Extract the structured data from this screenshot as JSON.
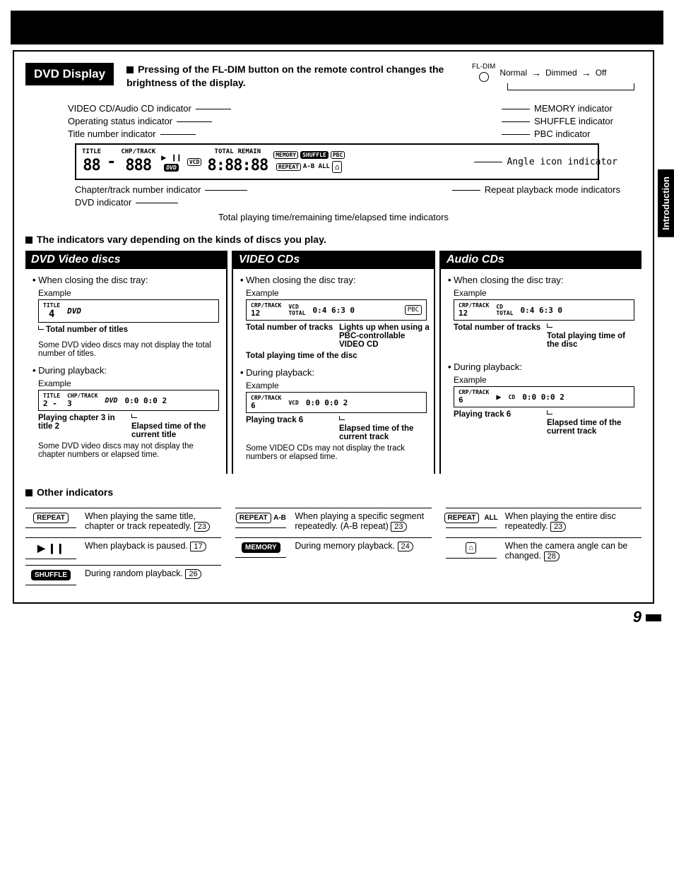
{
  "side_tab": "Introduction",
  "header": {
    "title": "DVD Display",
    "fl_dim_text": "Pressing of the FL-DIM button on the remote control changes the brightness of the display.",
    "fl_dim_label": "FL-DIM",
    "normal": "Normal",
    "dimmed": "Dimmed",
    "off": "Off"
  },
  "top_labels_left": {
    "l1": "VIDEO CD/Audio CD indicator",
    "l2": "Operating status indicator",
    "l3": "Title number indicator"
  },
  "top_labels_right": {
    "r1": "MEMORY indicator",
    "r2": "SHUFFLE indicator",
    "r3": "PBC indicator"
  },
  "display": {
    "title": "TITLE",
    "chptrack": "CHP/TRACK",
    "vcd": "VCD",
    "dvd": "DVD",
    "total": "TOTAL",
    "remain": "REMAIN",
    "memory": "MEMORY",
    "shuffle": "SHUFFLE",
    "pbc": "PBC",
    "repeat": "REPEAT",
    "ab_all": "A-B ALL",
    "seg_title": "88",
    "dash": "-",
    "seg_track": "888",
    "seg_time": "8:88:88"
  },
  "mid_right": {
    "angle": "Angle icon indicator",
    "repeat_mode": "Repeat playback mode indicators"
  },
  "bot_labels": {
    "b1": "Chapter/track number indicator",
    "b2": "DVD indicator",
    "b3": "Total playing time/remaining time/elapsed time indicators"
  },
  "sub_heading": "The indicators vary depending on the kinds of discs you play.",
  "columns": {
    "c1": {
      "heading": "DVD Video discs",
      "close": "When closing the disc tray:",
      "example": "Example",
      "disp1": {
        "tiny1": "TITLE",
        "val": "4",
        "dvd": "DVD"
      },
      "note1a": "Total number of titles",
      "note1b": "Some DVD video discs may not display the total number of titles.",
      "during": "During playback:",
      "disp2": {
        "tiny1": "TITLE",
        "v1": "2 -",
        "tiny2": "CHP/TRACK",
        "v2": "3",
        "dvd": "DVD",
        "time": "0:0 0:0 2"
      },
      "call_l": "Playing chapter 3 in title 2",
      "call_r": "Elapsed time of the current title",
      "note2": "Some DVD video discs may not display the chapter numbers or elapsed time."
    },
    "c2": {
      "heading": "VIDEO CDs",
      "close": "When closing the disc tray:",
      "example": "Example",
      "disp1": {
        "tiny": "CRP/TRACK",
        "val": "12",
        "vcd": "VCD",
        "tot": "TOTAL",
        "time": "0:4 6:3 0"
      },
      "call_l": "Total number of tracks",
      "call_r": "Lights up when using a PBC‑controllable VIDEO CD",
      "call_b": "Total playing time of the disc",
      "during": "During playback:",
      "disp2": {
        "tiny": "CRP/TRACK",
        "val": "6",
        "vcd": "VCD",
        "time": "0:0 0:0 2"
      },
      "call2_l": "Playing track 6",
      "call2_r": "Elapsed time of the current track",
      "note2": "Some VIDEO CDs may not display the track numbers or elapsed time."
    },
    "c3": {
      "heading": "Audio CDs",
      "close": "When closing the disc tray:",
      "example": "Example",
      "disp1": {
        "tiny": "CRP/TRACK",
        "val": "12",
        "cd": "CD",
        "tot": "TOTAL",
        "time": "0:4 6:3 0"
      },
      "call_l": "Total number of tracks",
      "call_r": "Total playing time of the disc",
      "during": "During playback:",
      "disp2": {
        "tiny": "CRP/TRACK",
        "val": "6",
        "cd": "CD",
        "time": "0:0 0:0 2"
      },
      "call2_l": "Playing track 6",
      "call2_r": "Elapsed time of the current track"
    }
  },
  "other": {
    "heading": "Other indicators",
    "items": {
      "repeat": {
        "label": "REPEAT",
        "text": "When playing the same title, chapter or track repeatedly.",
        "ref": "23"
      },
      "pause": {
        "label": "▶ ❙❙",
        "text": "When playback is paused.",
        "ref": "17"
      },
      "shuffle": {
        "label": "SHUFFLE",
        "text": "During random playback.",
        "ref": "26"
      },
      "repeat_ab": {
        "label": "REPEAT",
        "suffix": "A-B",
        "text": "When playing a specific segment repeatedly. (A-B repeat)",
        "ref": "23"
      },
      "memory": {
        "label": "MEMORY",
        "text": "During memory playback.",
        "ref": "24"
      },
      "repeat_all": {
        "label": "REPEAT",
        "suffix": "ALL",
        "text": "When playing the entire disc repeatedly.",
        "ref": "23"
      },
      "angle": {
        "label": "⌂",
        "text": "When the camera angle can be changed.",
        "ref": "28"
      }
    }
  },
  "page_number": "9"
}
